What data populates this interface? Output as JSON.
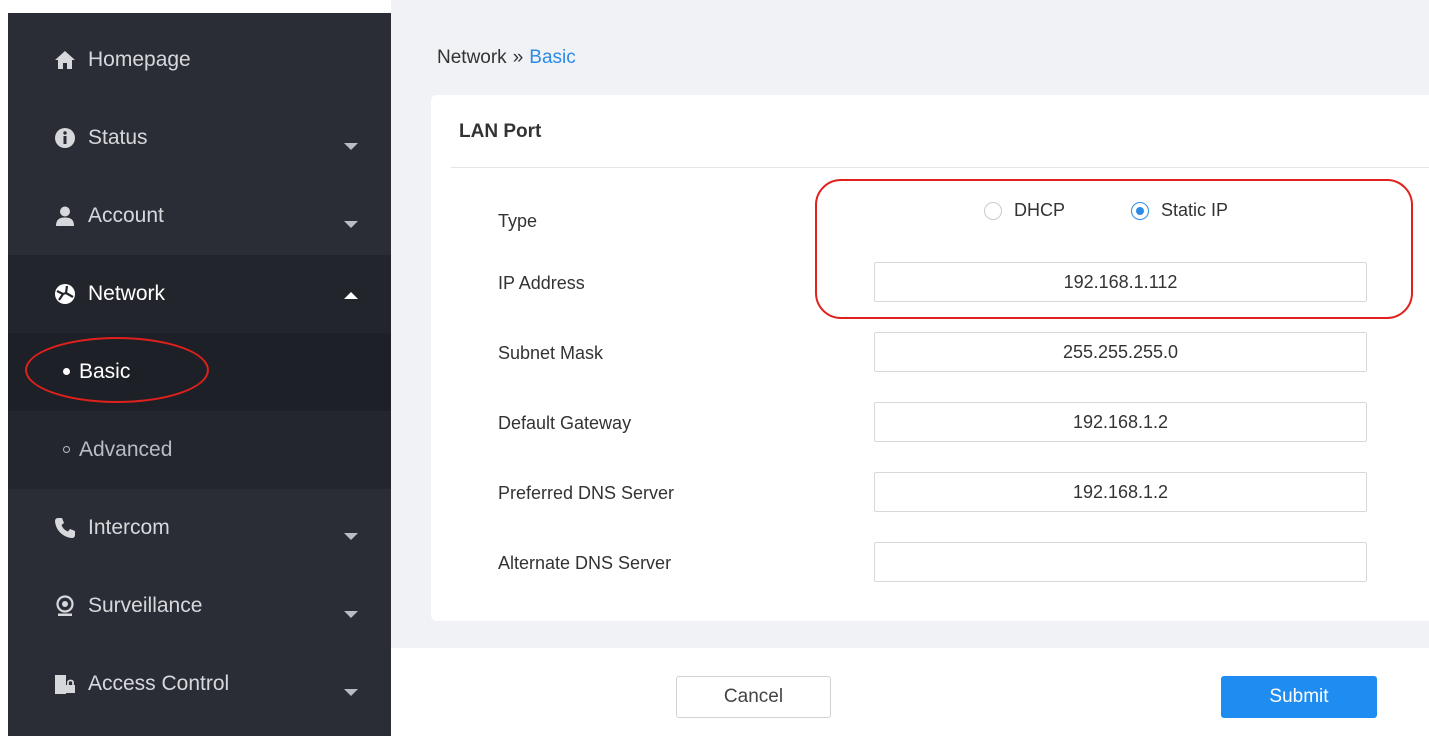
{
  "sidebar": {
    "items": [
      {
        "label": "Homepage",
        "icon": "home-icon"
      },
      {
        "label": "Status",
        "icon": "info-icon"
      },
      {
        "label": "Account",
        "icon": "user-icon"
      },
      {
        "label": "Network",
        "icon": "network-icon"
      },
      {
        "label": "Intercom",
        "icon": "phone-icon"
      },
      {
        "label": "Surveillance",
        "icon": "camera-icon"
      },
      {
        "label": "Access Control",
        "icon": "door-lock-icon"
      }
    ],
    "subitems": [
      {
        "label": "Basic",
        "active": true
      },
      {
        "label": "Advanced",
        "active": false
      }
    ]
  },
  "breadcrumb": {
    "parent": "Network",
    "separator": "»",
    "current": "Basic"
  },
  "card": {
    "title": "LAN Port"
  },
  "form": {
    "type_label": "Type",
    "type_options": [
      "DHCP",
      "Static IP"
    ],
    "type_selected": "Static IP",
    "ip_label": "IP Address",
    "ip_value": "192.168.1.112",
    "subnet_label": "Subnet Mask",
    "subnet_value": "255.255.255.0",
    "gateway_label": "Default Gateway",
    "gateway_value": "192.168.1.2",
    "dns1_label": "Preferred DNS Server",
    "dns1_value": "192.168.1.2",
    "dns2_label": "Alternate DNS Server",
    "dns2_value": ""
  },
  "buttons": {
    "cancel": "Cancel",
    "submit": "Submit"
  },
  "colors": {
    "accent": "#2b8be6",
    "sidebar": "#2a2d35",
    "highlight": "#e0201c"
  }
}
